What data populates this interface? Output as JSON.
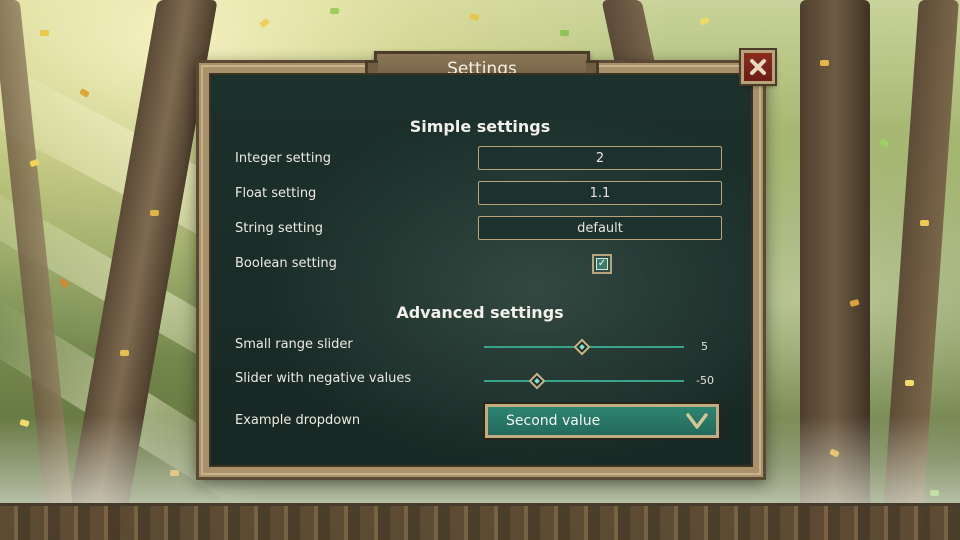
{
  "dialog": {
    "title": "Settings"
  },
  "simple_section": {
    "heading": "Simple settings",
    "integer_label": "Integer setting",
    "integer_value": "2",
    "float_label": "Float setting",
    "float_value": "1.1",
    "string_label": "String setting",
    "string_value": "default",
    "boolean_label": "Boolean setting",
    "boolean_value": true
  },
  "advanced_section": {
    "heading": "Advanced settings",
    "small_slider_label": "Small range slider",
    "small_slider_value": "5",
    "negative_slider_label": "Slider with negative values",
    "negative_slider_value": "-50",
    "dropdown_label": "Example dropdown",
    "dropdown_selected": "Second value"
  },
  "icons": {
    "close": "close-icon",
    "checkmark": "checkmark-icon",
    "dropdown_arrow": "chevron-down-icon"
  },
  "colors": {
    "panel_bg": "#1a2c28",
    "frame": "#a9926b",
    "accent_teal": "#2e8472",
    "close_red": "#8c2b1f"
  }
}
